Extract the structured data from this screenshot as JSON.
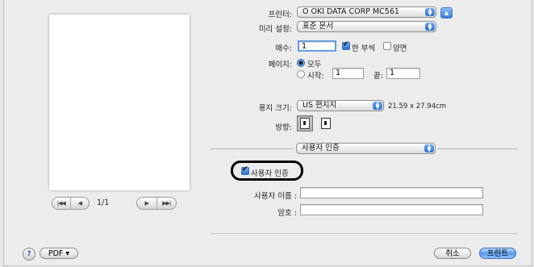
{
  "preview": {
    "page_counter": "1/1",
    "nav_first": "|◀◀",
    "nav_prev": "◀",
    "nav_next": "▶",
    "nav_last": "▶▶|"
  },
  "printer": {
    "label": "프린터:",
    "value": "O OKI DATA CORP MC561",
    "expand": "▲"
  },
  "presets": {
    "label": "미리 설정:",
    "value": "표준 문서"
  },
  "copies": {
    "label": "매수:",
    "value": "1",
    "collated_label": "한 부씩",
    "collated": true,
    "two_sided_label": "양면",
    "two_sided": false
  },
  "pages": {
    "label": "페이지:",
    "all_label": "모두",
    "from_label": "시작:",
    "from_value": "1",
    "to_label": "끝:",
    "to_value": "1"
  },
  "paper": {
    "label": "용지 크기:",
    "value": "US 편지지",
    "dimensions": "21.59 x 27.94cm"
  },
  "orientation": {
    "label": "방향:"
  },
  "panel": {
    "value": "사용자 인증"
  },
  "auth": {
    "checkbox_label": "사용자 인증",
    "checked": true,
    "username_label": "사용자 이름 :",
    "username_value": "",
    "password_label": "암호 :",
    "password_value": ""
  },
  "footer": {
    "help": "?",
    "pdf_label": "PDF ▾",
    "cancel_label": "취소",
    "print_label": "프린트"
  },
  "colors": {
    "accent": "#3a7ad9",
    "dialog_bg": "#ececec"
  }
}
